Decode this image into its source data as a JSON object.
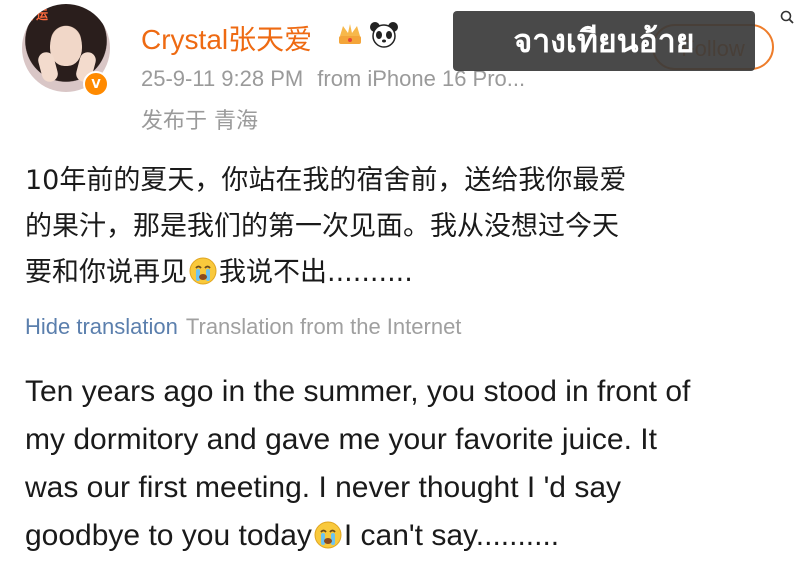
{
  "post": {
    "author": "Crystal张天爱",
    "badges": [
      "crown-icon",
      "panda-icon"
    ],
    "verified_label": "V",
    "avatar_sticker": "好运",
    "timestamp": "25-9-11 9:28 PM",
    "source": "from iPhone 16 Pro...",
    "location": "发布于 青海",
    "follow_label": "Follow",
    "overlay_text": "จางเทียนอ้าย",
    "original_lines": [
      "10年前的夏天，你站在我的宿舍前，送给我你最爱",
      "的果汁，那是我们的第一次见面。我从没想过今天",
      "要和你说再见",
      "我说不出.........."
    ],
    "hide_translation": "Hide translation",
    "translation_source": "Translation from the Internet",
    "translated_lines": [
      "Ten years ago in the summer, you stood in front of",
      "my dormitory and gave me your favorite juice. It",
      "was our first meeting. I never thought I 'd say",
      "goodbye to you today",
      "I can't say.........."
    ]
  },
  "colors": {
    "name": "#ee6a12",
    "meta": "#9a9a9a",
    "link": "#5b7fad",
    "overlay_bg": "#3a3a3a",
    "follow": "#ee7d2b"
  }
}
